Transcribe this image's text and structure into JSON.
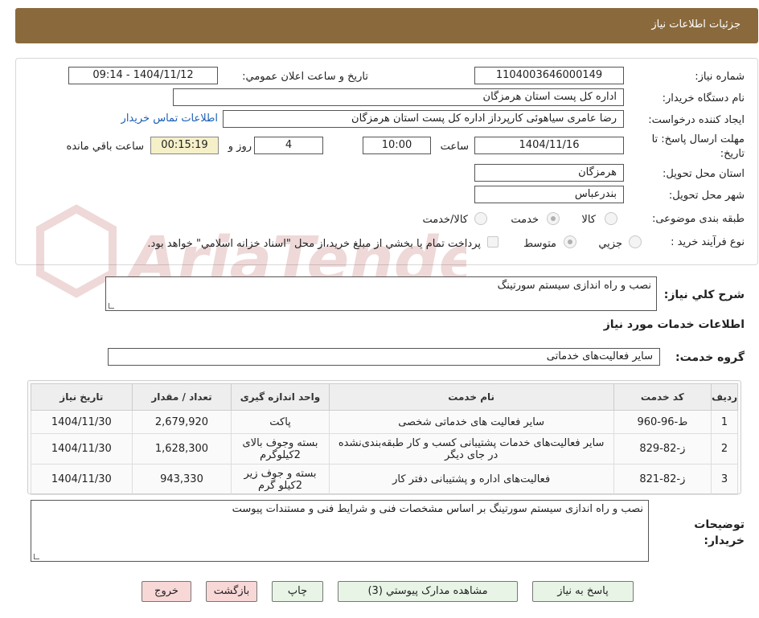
{
  "header": {
    "title": "جزئيات اطلاعات نياز"
  },
  "form": {
    "need_number_label": "شماره نياز:",
    "need_number": "1104003646000149",
    "announce_label": "تاريخ و ساعت اعلان عمومي:",
    "announce_value": "1404/11/12 - 09:14",
    "buyer_org_label": "نام دستگاه خريدار:",
    "buyer_org": "اداره کل پست استان هرمزگان",
    "requester_label": "ايجاد کننده درخواست:",
    "requester": "رضا عامری سیاهوئی کارپرداز اداره کل پست استان هرمزگان",
    "contact_link": "اطلاعات تماس خريدار",
    "deadline_label": "مهلت ارسال پاسخ: تا تاريخ:",
    "deadline_date": "1404/11/16",
    "time_label": "ساعت",
    "deadline_time": "10:00",
    "days_value": "4",
    "days_label": "روز و",
    "remaining_time": "00:15:19",
    "remaining_label": "ساعت باقي مانده",
    "province_label": "استان محل تحويل:",
    "province": "هرمزگان",
    "city_label": "شهر محل تحويل:",
    "city": "بندرعباس",
    "category_label": "طبقه بندی موضوعی:",
    "category_options": [
      "کالا",
      "خدمت",
      "کالا/خدمت"
    ],
    "category_selected": "خدمت",
    "process_label": "نوع فرآيند خريد :",
    "process_options": [
      "جزيي",
      "متوسط"
    ],
    "process_selected": "متوسط",
    "payment_note": "پرداخت تمام يا بخشي از مبلغ خريد،از محل \"اسناد خزانه اسلامي\" خواهد بود."
  },
  "summary": {
    "label": "شرح کلي نياز:",
    "value": "نصب و راه اندازی سیستم سورتینگ"
  },
  "services_section": {
    "title": "اطلاعات خدمات مورد نياز",
    "group_label": "گروه خدمت:",
    "group_value": "ساير فعاليت‌هاى خدماتى"
  },
  "table": {
    "headers": [
      "رديف",
      "کد خدمت",
      "نام خدمت",
      "واحد اندازه گيری",
      "تعداد / مقدار",
      "تاريخ نياز"
    ],
    "rows": [
      [
        "1",
        "ط-96-960",
        "سایر فعالیت های خدماتی شخصی",
        "پاکت",
        "2,679,920",
        "1404/11/30"
      ],
      [
        "2",
        "ز-82-829",
        "سایر فعالیت‌های خدمات پشتیبانی کسب و کار طبقه‌بندی‌نشده در جای دیگر",
        "بسته وجوف بالای 2کیلوگرم",
        "1,628,300",
        "1404/11/30"
      ],
      [
        "3",
        "ز-82-821",
        "فعالیت‌های اداره و پشتیبانی دفتر کار",
        "بسته و جوف زیر 2کیلو گرم",
        "943,330",
        "1404/11/30"
      ]
    ]
  },
  "buyer_notes": {
    "label": "توضيحات خريدار:",
    "value": "نصب و راه اندازی سیستم سورتینگ بر اساس مشخصات فنی و شرایط فنی و مستندات پیوست"
  },
  "buttons": {
    "reply": "پاسخ به نياز",
    "attachments": "مشاهده مدارک پيوستي (3)",
    "print": "چاپ",
    "back": "بازگشت",
    "exit": "خروج"
  },
  "watermark": {
    "text": "AriaTender.neT"
  },
  "colors": {
    "header_bg": "#8a6a3c",
    "link": "#1a5fb4",
    "button_green": "#e8f5e6",
    "button_pink": "#f8d7d7",
    "timer_bg": "#f5f0c8"
  }
}
